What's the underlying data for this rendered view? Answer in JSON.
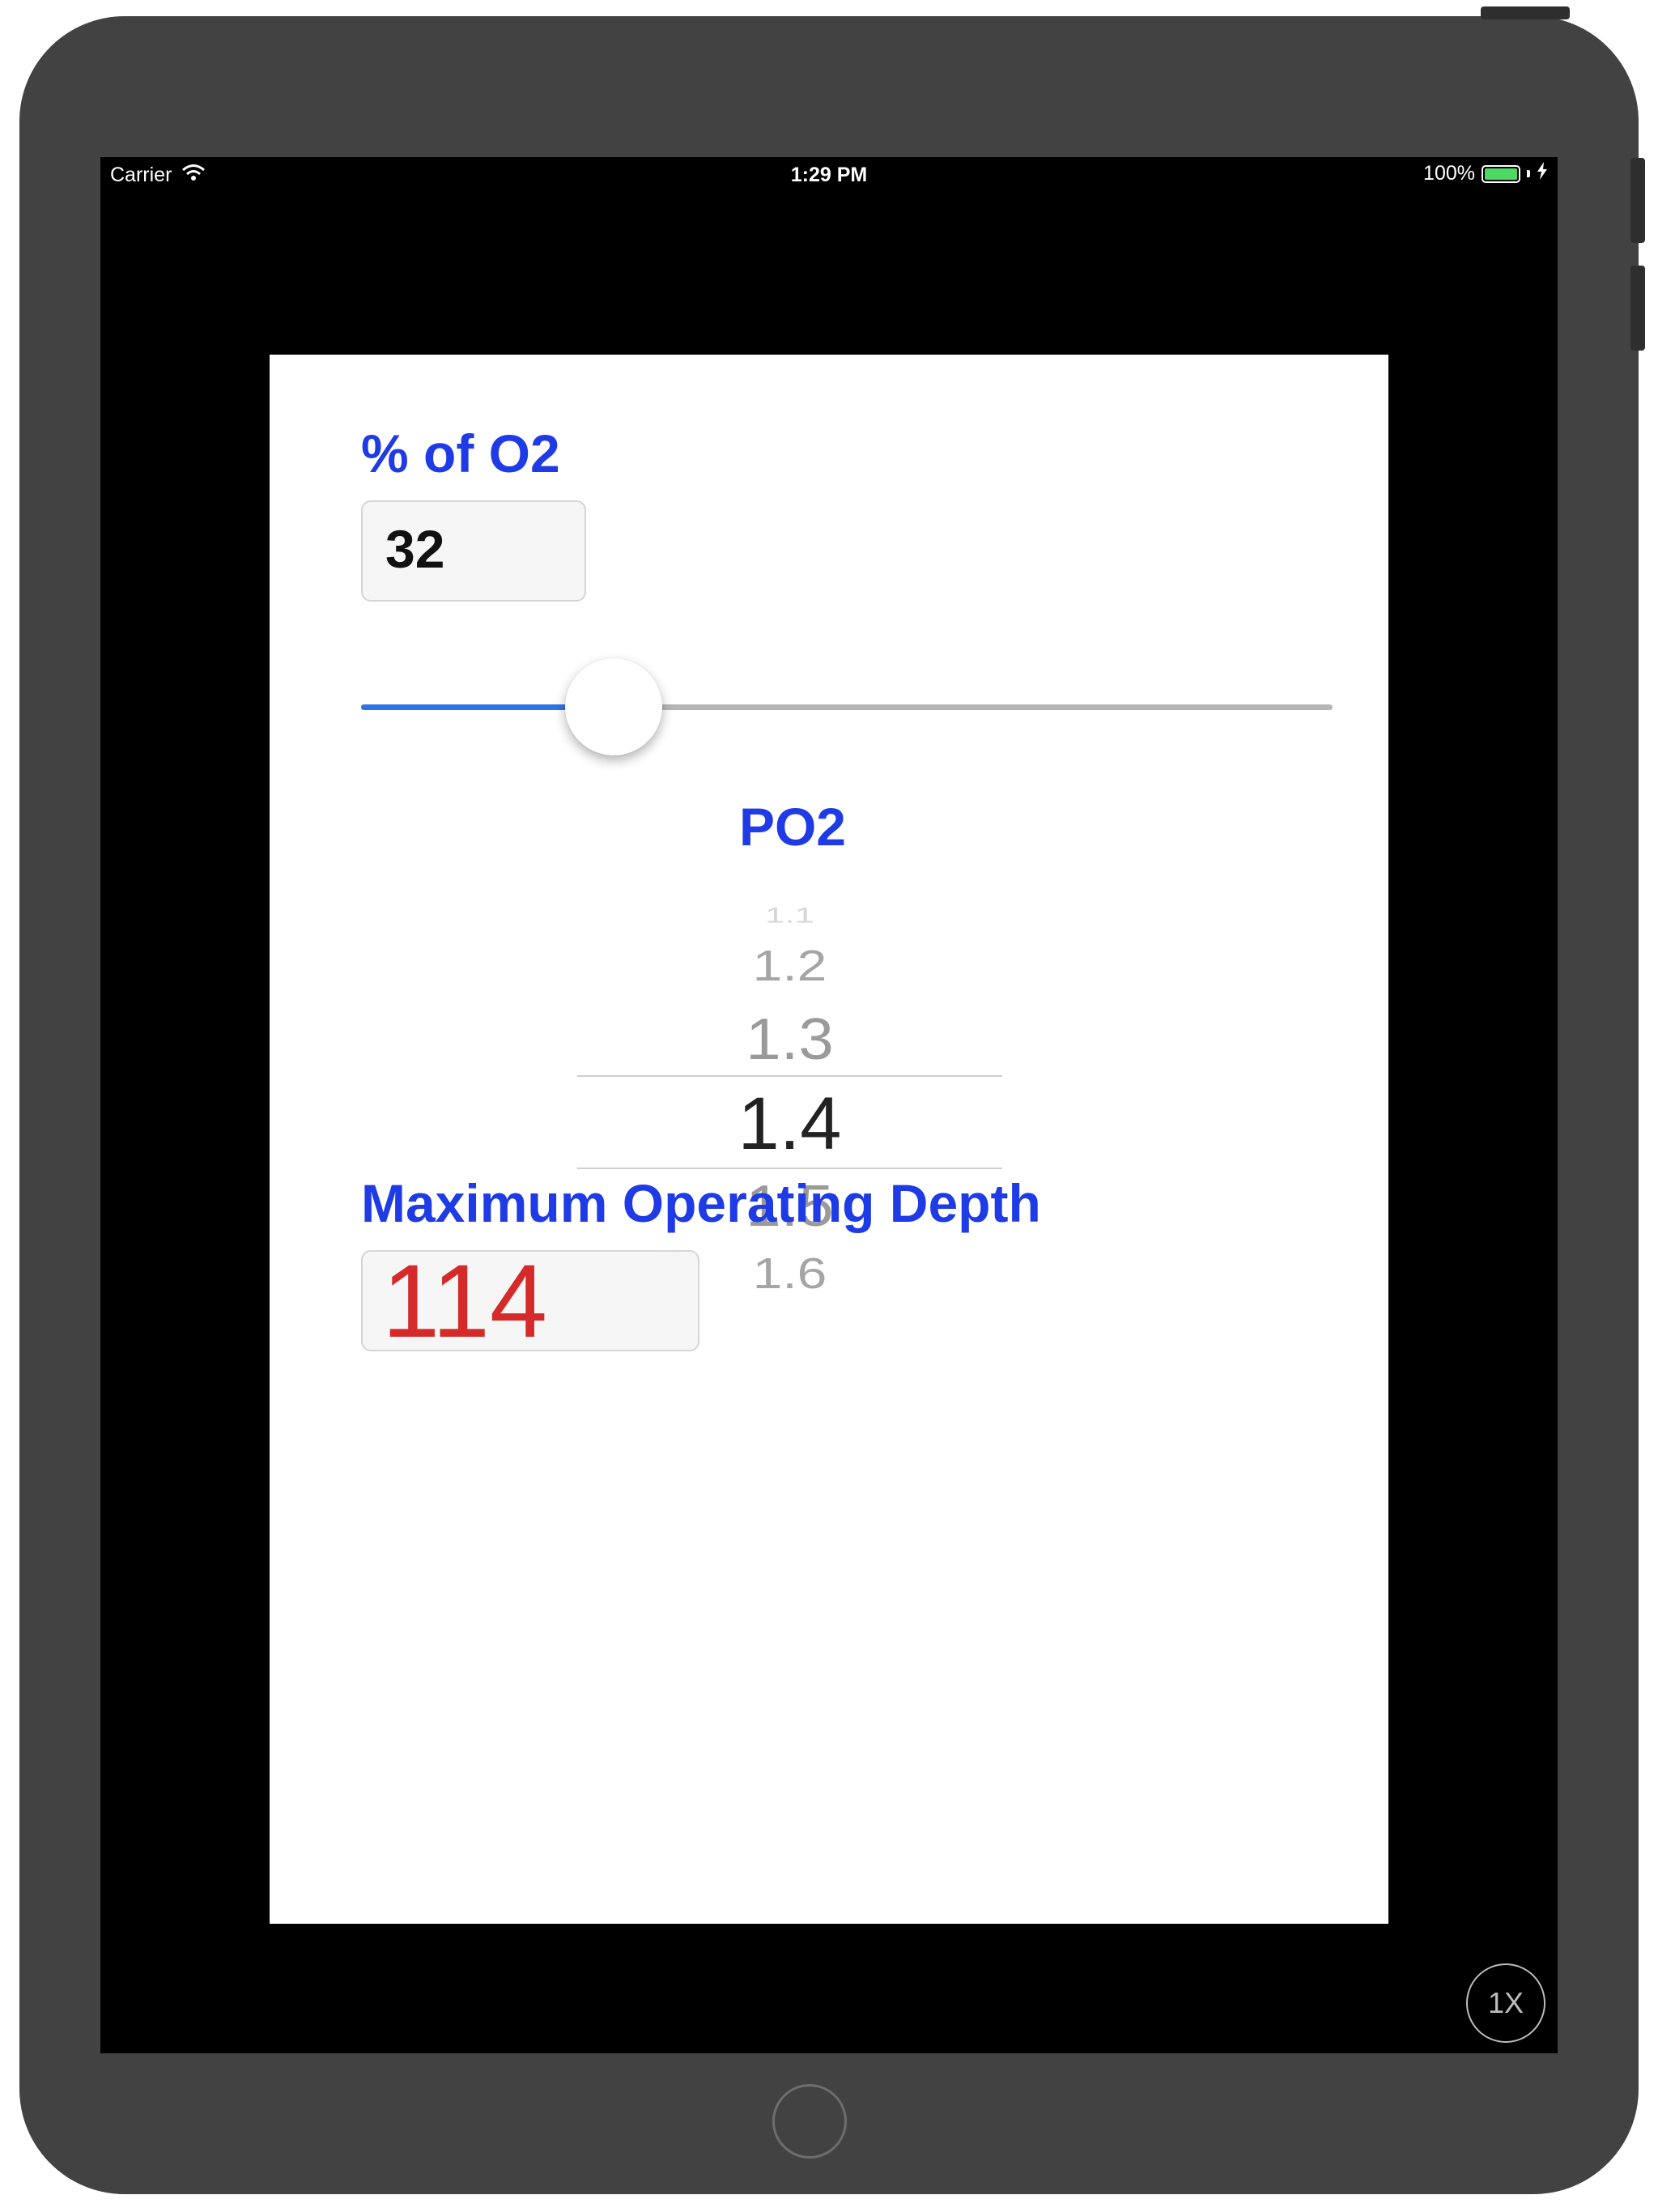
{
  "status_bar": {
    "carrier": "Carrier",
    "time": "1:29 PM",
    "battery": "100%",
    "battery_level": 1.0
  },
  "app": {
    "o2_label": "% of O2",
    "o2_value": "32",
    "slider_value_fraction": 0.26,
    "po2_label": "PO2",
    "po2_options": [
      "1.1",
      "1.2",
      "1.3",
      "1.4",
      "1.5",
      "1.6"
    ],
    "po2_selected": "1.4",
    "mod_label": "Maximum Operating Depth",
    "mod_value": "114"
  },
  "simulator": {
    "zoom_label": "1X"
  },
  "colors": {
    "label_blue": "#1f3be6",
    "mod_red": "#d42a2a",
    "slider_fill": "#2f73e7",
    "battery_green": "#4cd964"
  },
  "icons": [
    "wifi-icon",
    "battery-icon",
    "charging-bolt-icon"
  ]
}
